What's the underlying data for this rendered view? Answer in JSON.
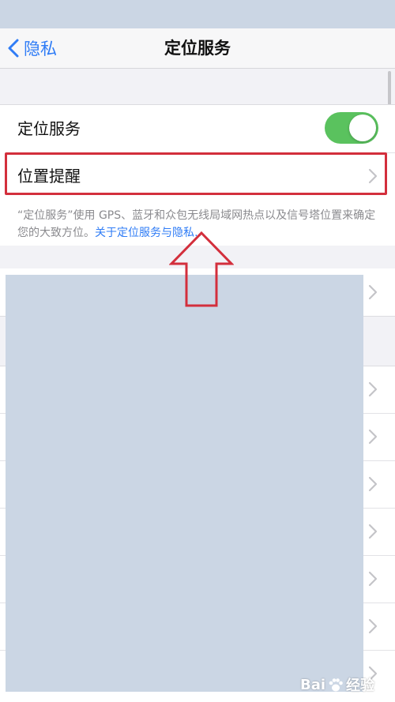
{
  "nav": {
    "back_label": "隐私",
    "title": "定位服务"
  },
  "settings": {
    "location_services_label": "定位服务",
    "location_services_enabled": true,
    "location_alerts_label": "位置提醒"
  },
  "footer": {
    "description": "“定位服务”使用 GPS、蓝牙和众包无线局域网热点以及信号塔位置来确定您的大致方位。",
    "link_text": "关于定位服务与隐私…"
  },
  "watermark": {
    "brand_left": "Bai",
    "brand_right": "经验"
  },
  "colors": {
    "accent_blue": "#2f7cf6",
    "toggle_green": "#5ac25e",
    "highlight_red": "#d32f3c",
    "redaction": "#cbd6e4"
  },
  "icons": {
    "back": "chevron-left-icon",
    "row_disclosure": "chevron-right-icon",
    "annotation": "up-arrow-icon",
    "watermark_logo": "paw-icon"
  }
}
